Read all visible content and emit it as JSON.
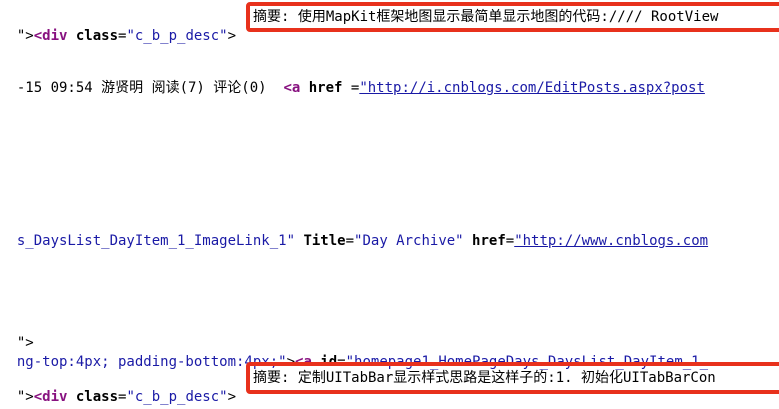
{
  "lines": {
    "l1": {
      "pre": "\">",
      "tag": "<div",
      "attr": " class",
      "eq": "=",
      "val": "\"c_b_p_desc\"",
      "close": ">",
      "summary": "摘要: 使用MapKit框架地图显示最简单显示地图的代码://// RootView"
    },
    "l2": {
      "text": "-15 09:54 游贤明 阅读(7) 评论(0)  ",
      "tag": "<a",
      "attr": " href",
      "eq": " =",
      "link": "\"http://i.cnblogs.com/EditPosts.aspx?post"
    },
    "l3": {
      "val": "s_DaysList_DayItem_1_ImageLink_1\"",
      "attr1": " Title",
      "eq1": "=",
      "val2": "\"Day Archive\"",
      "attr2": " href",
      "eq2": "=",
      "link": "\"http://www.cnblogs.com"
    },
    "l4": {
      "text": "\">"
    },
    "l5": {
      "val": "ng-top:4px; padding-bottom:4px;\"",
      "close": ">",
      "tag": "<a",
      "attr": " id",
      "eq": "=",
      "val2": "\"homepage1_HomePageDays_DaysList_DayItem_1_"
    },
    "l6": {
      "pre": "\">",
      "tag": "<div",
      "attr": " class",
      "eq": "=",
      "val": "\"c_b_p_desc\"",
      "close": ">",
      "summary": "摘要: 定制UITabBar显示样式思路是这样子的:1. 初始化UITabBarCon"
    }
  }
}
